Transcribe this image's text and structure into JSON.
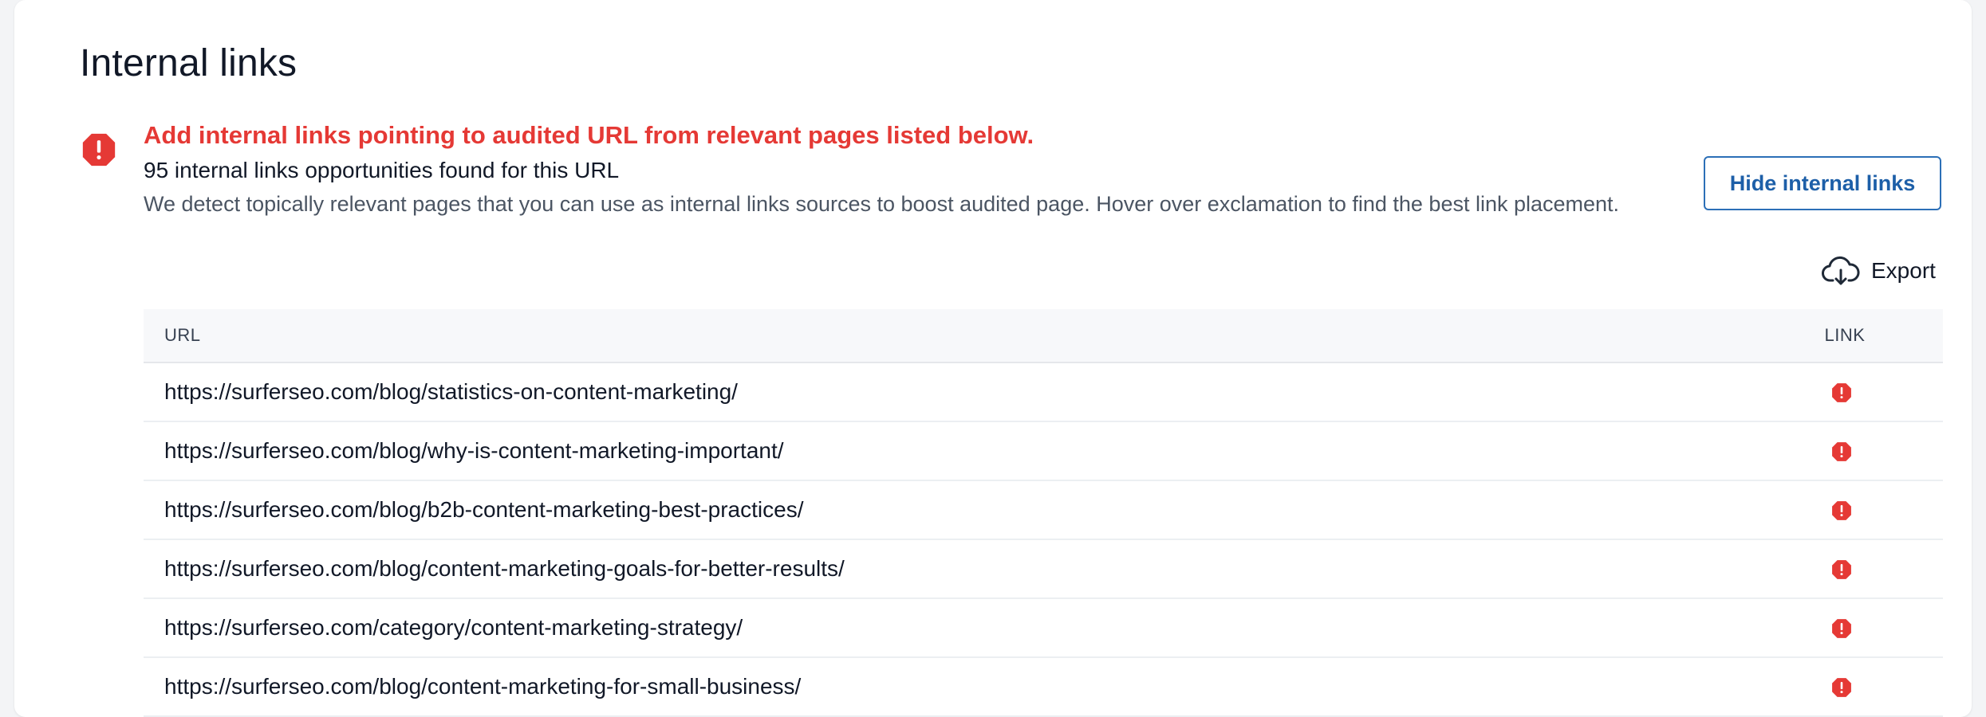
{
  "page_title": "Internal links",
  "alert": {
    "headline": "Add internal links pointing to audited URL from relevant pages listed below.",
    "count_text": "95 internal links opportunities found for this URL",
    "description": "We detect topically relevant pages that you can use as internal links sources to boost audited page. Hover over exclamation to find the best link placement.",
    "icon": "alert-octagon-icon",
    "color": "#e53935"
  },
  "actions": {
    "hide_label": "Hide internal links",
    "export_label": "Export",
    "export_icon": "cloud-download-icon",
    "accent_color": "#2c6fb7"
  },
  "table": {
    "columns": [
      "URL",
      "LINK"
    ],
    "rows": [
      {
        "url": "https://surferseo.com/blog/statistics-on-content-marketing/",
        "link_icon": "alert-octagon-icon"
      },
      {
        "url": "https://surferseo.com/blog/why-is-content-marketing-important/",
        "link_icon": "alert-octagon-icon"
      },
      {
        "url": "https://surferseo.com/blog/b2b-content-marketing-best-practices/",
        "link_icon": "alert-octagon-icon"
      },
      {
        "url": "https://surferseo.com/blog/content-marketing-goals-for-better-results/",
        "link_icon": "alert-octagon-icon"
      },
      {
        "url": "https://surferseo.com/category/content-marketing-strategy/",
        "link_icon": "alert-octagon-icon"
      },
      {
        "url": "https://surferseo.com/blog/content-marketing-for-small-business/",
        "link_icon": "alert-octagon-icon"
      }
    ]
  }
}
